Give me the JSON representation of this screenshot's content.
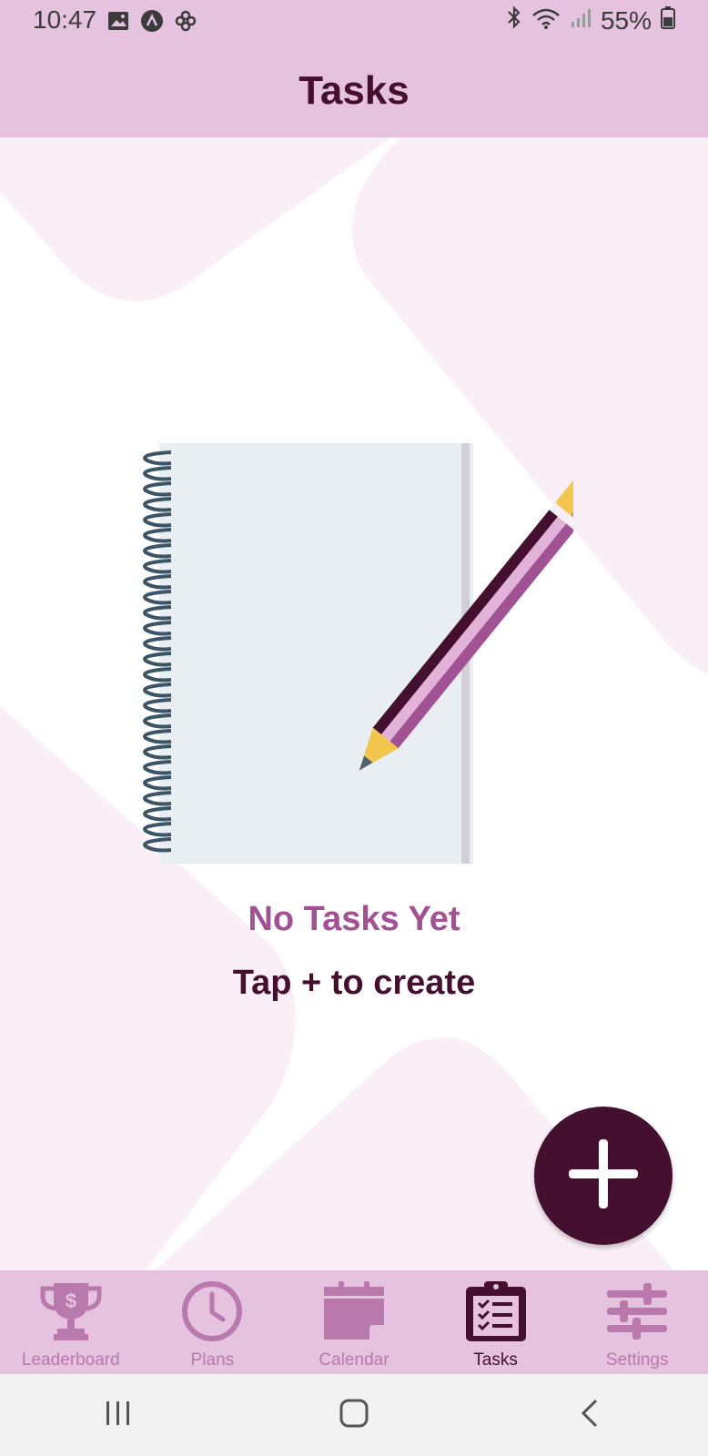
{
  "status_bar": {
    "time": "10:47",
    "battery": "55%",
    "left_icons": [
      "gallery-icon",
      "app-notification-icon",
      "pinwheel-icon"
    ],
    "right_icons": [
      "bluetooth-icon",
      "wifi-icon",
      "signal-icon",
      "battery-icon"
    ]
  },
  "header": {
    "title": "Tasks"
  },
  "empty_state": {
    "title": "No Tasks Yet",
    "subtitle": "Tap + to create",
    "illustration": "notebook-with-pencil"
  },
  "fab": {
    "icon": "plus-icon"
  },
  "bottom_nav": {
    "items": [
      {
        "label": "Leaderboard",
        "icon": "trophy-icon",
        "active": false
      },
      {
        "label": "Plans",
        "icon": "clock-icon",
        "active": false
      },
      {
        "label": "Calendar",
        "icon": "calendar-icon",
        "active": false
      },
      {
        "label": "Tasks",
        "icon": "clipboard-icon",
        "active": true
      },
      {
        "label": "Settings",
        "icon": "sliders-icon",
        "active": false
      }
    ]
  },
  "system_nav": {
    "buttons": [
      "recent-apps-icon",
      "home-icon",
      "back-icon"
    ]
  },
  "colors": {
    "header_bg": "#e5c2de",
    "primary_dark": "#45102f",
    "accent": "#a05293",
    "inactive": "#b979ad",
    "background_tint": "#fbeff7"
  }
}
